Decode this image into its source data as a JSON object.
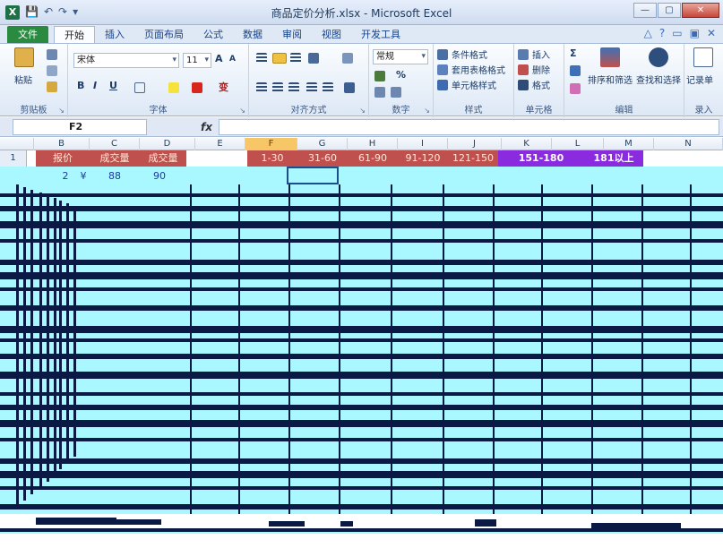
{
  "window": {
    "title": "商品定价分析.xlsx - Microsoft Excel",
    "app_icon": "X",
    "qat": [
      "💾",
      "↶",
      "↷",
      "▾"
    ],
    "buttons": {
      "minimize": "—",
      "restore": "▢",
      "close": "✕"
    }
  },
  "tabs": [
    {
      "label": "文件",
      "kind": "file"
    },
    {
      "label": "开始",
      "kind": "active"
    },
    {
      "label": "插入",
      "kind": "normal"
    },
    {
      "label": "页面布局",
      "kind": "normal"
    },
    {
      "label": "公式",
      "kind": "normal"
    },
    {
      "label": "数据",
      "kind": "normal"
    },
    {
      "label": "审阅",
      "kind": "normal"
    },
    {
      "label": "视图",
      "kind": "normal"
    },
    {
      "label": "开发工具",
      "kind": "normal"
    }
  ],
  "help_icons": [
    "△",
    "?",
    "▭",
    "▣",
    "✕"
  ],
  "ribbon": {
    "clipboard": {
      "paste": "粘贴",
      "label": "剪贴板"
    },
    "font": {
      "name": "宋体",
      "size": "11",
      "label": "字体",
      "bold": "B",
      "italic": "I",
      "underline": "U",
      "grow": "A",
      "shrink": "A",
      "wen": "变"
    },
    "align": {
      "label": "对齐方式"
    },
    "number": {
      "format": "常规",
      "label": "数字",
      "percent": "%"
    },
    "styles": {
      "conditional": "条件格式",
      "table": "套用表格格式",
      "cell": "单元格样式",
      "label": "样式"
    },
    "cells": {
      "insert": "插入",
      "delete": "删除",
      "format": "格式",
      "label": "单元格"
    },
    "editing": {
      "sort": "排序和筛选",
      "find": "查找和选择",
      "label": "编辑",
      "sigma": "Σ"
    },
    "record": {
      "button": "记录单",
      "label": "录入"
    }
  },
  "formula_bar": {
    "name_box": "F2",
    "fx": "fx",
    "value": ""
  },
  "columns": [
    "B",
    "C",
    "D",
    "E",
    "F",
    "G",
    "H",
    "I",
    "J",
    "K",
    "L",
    "M",
    "N"
  ],
  "selected_column": "F",
  "row1": {
    "row_number": "1",
    "headers": [
      "报价",
      "成交量",
      "成交量",
      "1-30",
      "31-60",
      "61-90",
      "91-120",
      "121-150",
      "151-180",
      "181以上"
    ]
  },
  "row2": {
    "b": "2",
    "currency": "¥",
    "c": "88",
    "d": "90"
  },
  "colors": {
    "header_red": "#c0504d",
    "header_purple": "#8b2be0",
    "cyan_fill": "#aaf8ff",
    "excel_green": "#1e7145"
  }
}
